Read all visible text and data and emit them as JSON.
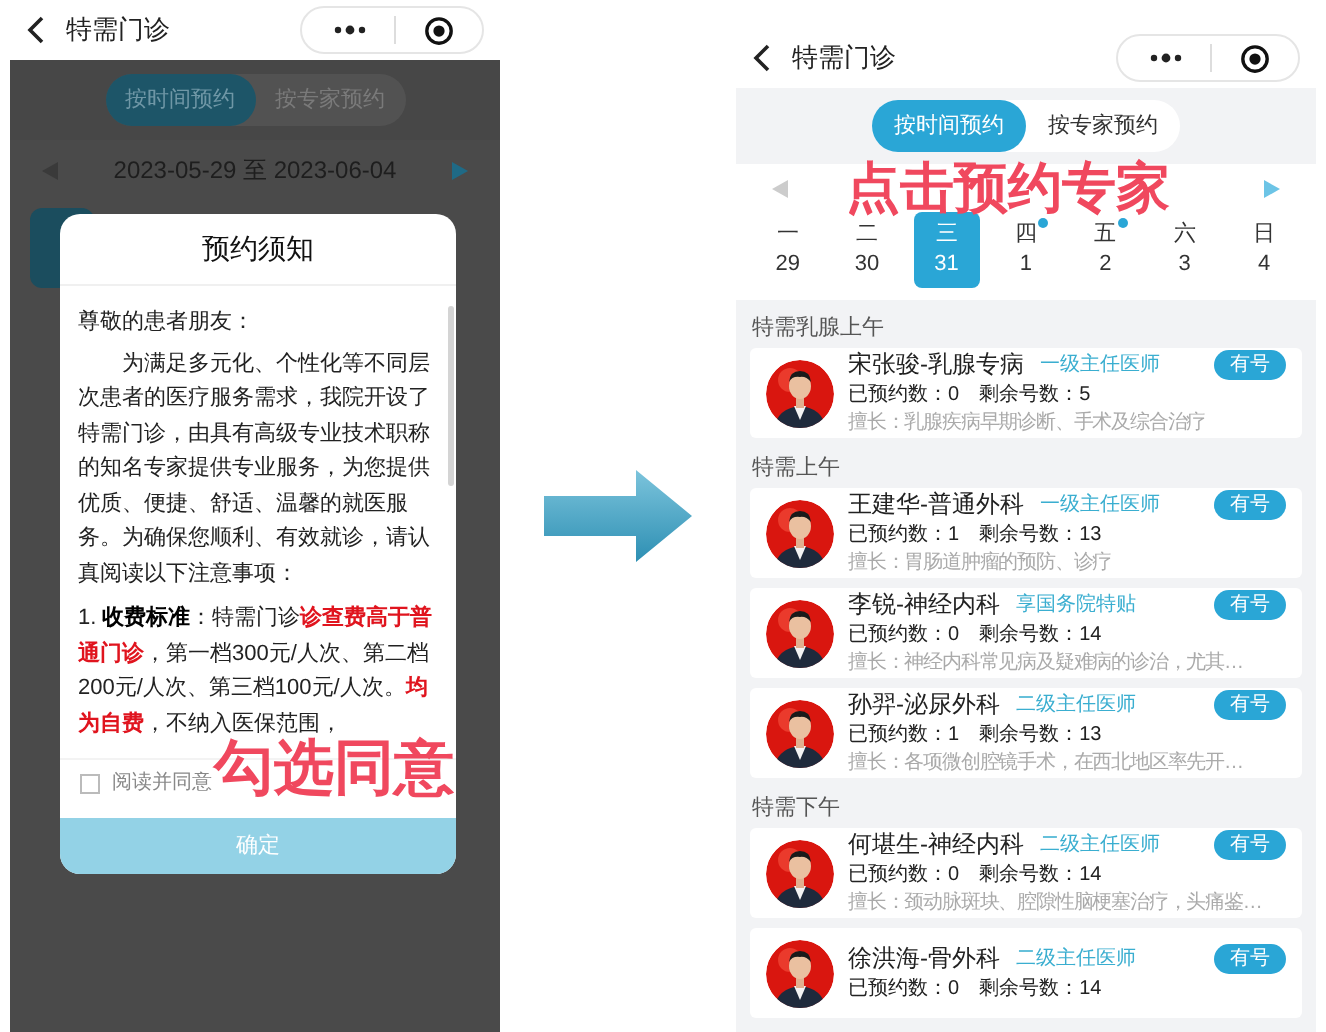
{
  "left": {
    "header": {
      "title": "特需门诊"
    },
    "tabs": [
      {
        "label": "按时间预约",
        "selected": true
      },
      {
        "label": "按专家预约",
        "selected": false
      }
    ],
    "date_range": "2023-05-29 至 2023-06-04",
    "modal": {
      "title": "预约须知",
      "greeting": "尊敬的患者朋友：",
      "intro": "为满足多元化、个性化等不同层次患者的医疗服务需求，我院开设了特需门诊，由具有高级专业技术职称的知名专家提供专业服务，为您提供优质、便捷、舒适、温馨的就医服务。为确保您顺利、有效就诊，请认真阅读以下注意事项：",
      "rule": [
        {
          "kind": "plain",
          "text": "1. "
        },
        {
          "kind": "bold",
          "text": "收费标准"
        },
        {
          "kind": "plain",
          "text": "：特需门诊"
        },
        {
          "kind": "red",
          "text": "诊查费高于普通门诊"
        },
        {
          "kind": "plain",
          "text": "，第一档300元/人次、第二档200元/人次、第三档100元/人次。"
        },
        {
          "kind": "red",
          "text": "均为自费"
        },
        {
          "kind": "plain",
          "text": "，不纳入医保范围，"
        }
      ],
      "agree": {
        "label": "阅读并同意",
        "checked": false
      },
      "confirm": {
        "label": "确定",
        "disabled": true
      }
    },
    "annotation": "勾选同意"
  },
  "right": {
    "header": {
      "title": "特需门诊"
    },
    "tabs": [
      {
        "label": "按时间预约",
        "selected": true
      },
      {
        "label": "按专家预约",
        "selected": false
      }
    ],
    "days": [
      {
        "weekday": "一",
        "date": "29",
        "selected": false,
        "dot": false
      },
      {
        "weekday": "二",
        "date": "30",
        "selected": false,
        "dot": false
      },
      {
        "weekday": "三",
        "date": "31",
        "selected": true,
        "dot": false
      },
      {
        "weekday": "四",
        "date": "1",
        "selected": false,
        "dot": true
      },
      {
        "weekday": "五",
        "date": "2",
        "selected": false,
        "dot": true
      },
      {
        "weekday": "六",
        "date": "3",
        "selected": false,
        "dot": false
      },
      {
        "weekday": "日",
        "date": "4",
        "selected": false,
        "dot": false
      }
    ],
    "annotation": "点击预约专家",
    "sections": [
      {
        "title": "特需乳腺上午",
        "doctors": [
          {
            "name": "宋张骏-乳腺专病",
            "title": "一级主任医师",
            "badge": "有号",
            "booked": "已预约数：0",
            "remaining": "剩余号数：5",
            "specialty": "擅长：乳腺疾病早期诊断、手术及综合治疗"
          }
        ]
      },
      {
        "title": "特需上午",
        "doctors": [
          {
            "name": "王建华-普通外科",
            "title": "一级主任医师",
            "badge": "有号",
            "booked": "已预约数：1",
            "remaining": "剩余号数：13",
            "specialty": "擅长：胃肠道肿瘤的预防、诊疗"
          },
          {
            "name": "李锐-神经内科",
            "title": "享国务院特贴",
            "badge": "有号",
            "booked": "已预约数：0",
            "remaining": "剩余号数：14",
            "specialty": "擅长：神经内科常见病及疑难病的诊治，尤其…"
          },
          {
            "name": "孙羿-泌尿外科",
            "title": "二级主任医师",
            "badge": "有号",
            "booked": "已预约数：1",
            "remaining": "剩余号数：13",
            "specialty": "擅长：各项微创腔镜手术，在西北地区率先开…"
          }
        ]
      },
      {
        "title": "特需下午",
        "doctors": [
          {
            "name": "何堪生-神经内科",
            "title": "二级主任医师",
            "badge": "有号",
            "booked": "已预约数：0",
            "remaining": "剩余号数：14",
            "specialty": "擅长：颈动脉斑块、腔隙性脑梗塞治疗，头痛鉴…"
          },
          {
            "name": "徐洪海-骨外科",
            "title": "二级主任医师",
            "badge": "有号",
            "booked": "已预约数：0",
            "remaining": "剩余号数：14"
          }
        ]
      }
    ]
  }
}
